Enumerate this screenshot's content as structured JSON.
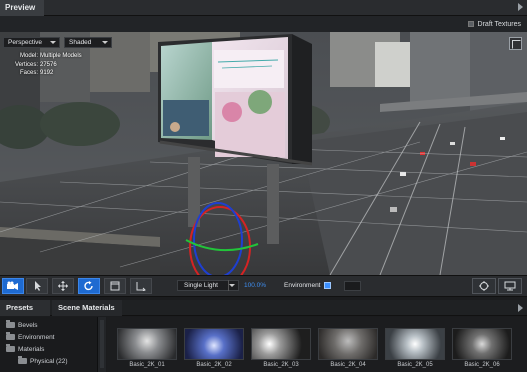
{
  "header": {
    "title": "Preview"
  },
  "subheader": {
    "draft_textures_label": "Draft Textures"
  },
  "viewport": {
    "camera_dropdown": "Perspective",
    "shading_dropdown": "Shaded",
    "stats": {
      "model_key": "Model:",
      "model_val": "Multiple Models",
      "vertices_key": "Vertices:",
      "vertices_val": "27576",
      "faces_key": "Faces:",
      "faces_val": "9192"
    }
  },
  "toolbar": {
    "tools": [
      "camera-icon",
      "select-arrow-icon",
      "move-icon",
      "rotate-icon",
      "frame-icon",
      "scale-icon"
    ],
    "active_tool": "rotate-icon",
    "light_dropdown": "Single Light",
    "zoom": "100.0%",
    "environment_label": "Environment",
    "environment_checked": true
  },
  "panel": {
    "tabs": [
      "Presets",
      "Scene Materials"
    ],
    "tree": [
      {
        "label": "Bevels"
      },
      {
        "label": "Environment"
      },
      {
        "label": "Materials"
      },
      {
        "label": "Physical (22)"
      }
    ],
    "thumbnails": [
      "Basic_2K_01",
      "Basic_2K_02",
      "Basic_2K_03",
      "Basic_2K_04",
      "Basic_2K_05",
      "Basic_2K_06"
    ]
  },
  "colors": {
    "accent": "#1e6ad1",
    "link": "#3f8ef0",
    "panel_bg": "#1b1c1e"
  }
}
